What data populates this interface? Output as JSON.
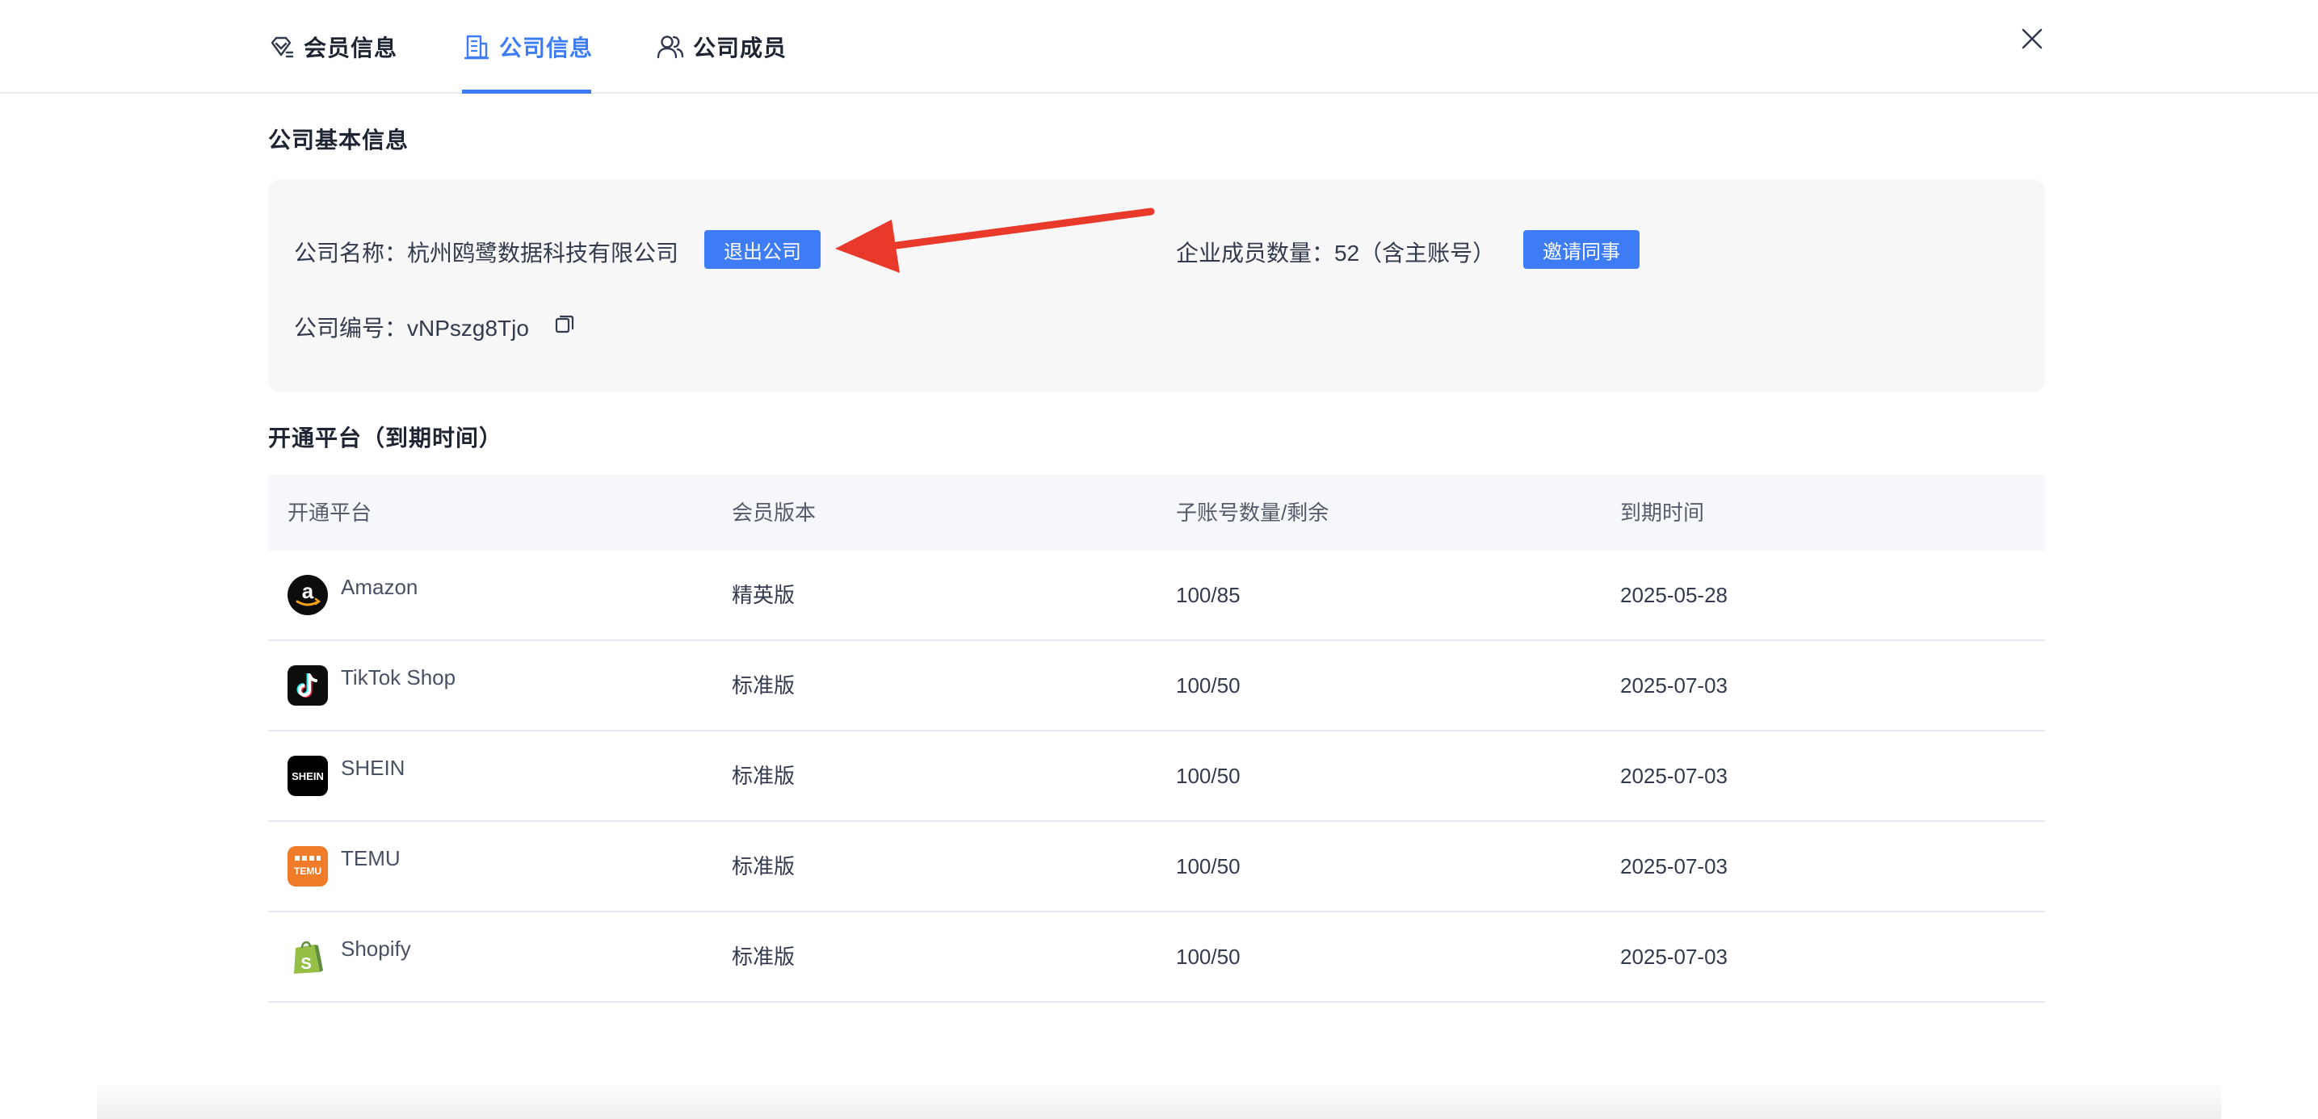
{
  "tabs": [
    {
      "label": "会员信息",
      "icon": "member-diamond-icon",
      "active": false
    },
    {
      "label": "公司信息",
      "icon": "company-building-icon",
      "active": true
    },
    {
      "label": "公司成员",
      "icon": "members-group-icon",
      "active": false
    }
  ],
  "close_icon": "close-icon",
  "basic_info": {
    "title": "公司基本信息",
    "company_name_label": "公司名称：杭州鸥鹭数据科技有限公司",
    "exit_button": "退出公司",
    "member_count_label": "企业成员数量：52（含主账号）",
    "invite_button": "邀请同事",
    "company_code_label": "公司编号：vNPszg8Tjo",
    "copy_icon": "copy-icon"
  },
  "annotation": {
    "arrow_color": "#e8392b"
  },
  "platforms": {
    "title": "开通平台（到期时间）",
    "columns": [
      "开通平台",
      "会员版本",
      "子账号数量/剩余",
      "到期时间"
    ],
    "rows": [
      {
        "platform": "Amazon",
        "logo": "amazon-logo-icon",
        "version": "精英版",
        "accounts": "100/85",
        "expiry": "2025-05-28"
      },
      {
        "platform": "TikTok Shop",
        "logo": "tiktok-logo-icon",
        "version": "标准版",
        "accounts": "100/50",
        "expiry": "2025-07-03"
      },
      {
        "platform": "SHEIN",
        "logo": "shein-logo-icon",
        "version": "标准版",
        "accounts": "100/50",
        "expiry": "2025-07-03"
      },
      {
        "platform": "TEMU",
        "logo": "temu-logo-icon",
        "version": "标准版",
        "accounts": "100/50",
        "expiry": "2025-07-03"
      },
      {
        "platform": "Shopify",
        "logo": "shopify-logo-icon",
        "version": "标准版",
        "accounts": "100/50",
        "expiry": "2025-07-03"
      }
    ]
  },
  "colors": {
    "accent": "#3d7cf5",
    "text": "#333a4d",
    "card_bg": "#f7f7f8"
  }
}
